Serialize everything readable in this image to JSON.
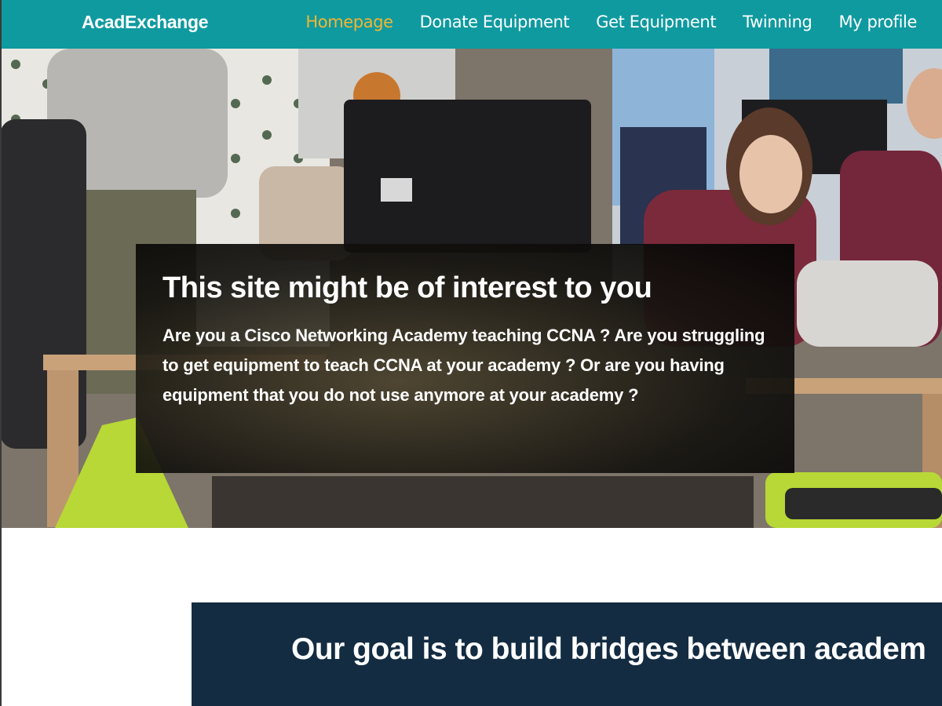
{
  "navbar": {
    "brand": "AcadExchange",
    "links": [
      {
        "label": "Homepage",
        "active": true
      },
      {
        "label": "Donate Equipment",
        "active": false
      },
      {
        "label": "Get Equipment",
        "active": false
      },
      {
        "label": "Twinning",
        "active": false
      },
      {
        "label": "My profile",
        "active": false
      }
    ],
    "background": "#0f9aa0",
    "active_color": "#f2b632"
  },
  "hero": {
    "title": "This site might be of interest to you",
    "text": "Are you a Cisco Networking Academy teaching CCNA ? Are you struggling to get equipment to teach CCNA at your academy ? Or are you having equipment that you do not use anymore at your academy ?"
  },
  "goal": {
    "title": "Our goal is to build bridges between academ",
    "background": "#132c42"
  }
}
